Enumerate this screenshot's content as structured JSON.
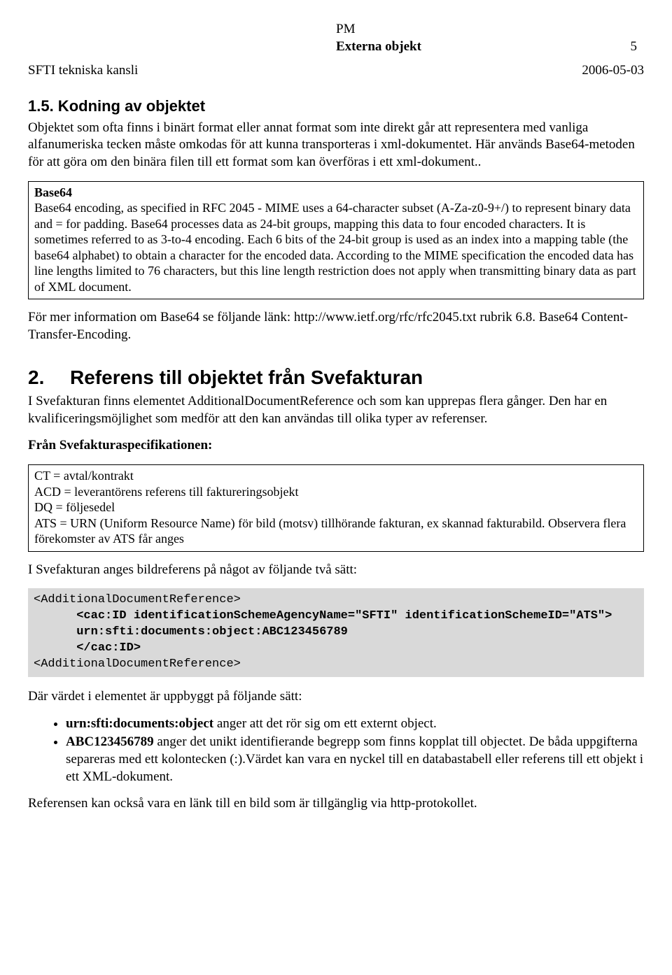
{
  "header": {
    "pm": "PM",
    "title": "Externa objekt",
    "page_number": "5",
    "org": "SFTI tekniska kansli",
    "date": "2006-05-03"
  },
  "section15": {
    "heading": "1.5. Kodning av objektet",
    "para1": "Objektet som ofta finns i binärt format eller annat format som inte direkt går att representera med vanliga alfanumeriska tecken måste omkodas för att kunna transporteras i xml-dokumentet. Här används Base64-metoden för att göra om den binära filen till ett format som kan överföras i ett xml-dokument..",
    "box": {
      "title": "Base64",
      "body": "Base64 encoding, as specified in RFC 2045 - MIME uses a 64-character subset (A-Za-z0-9+/) to represent binary data and = for padding. Base64 processes data as 24-bit groups, mapping this data to four encoded characters. It is sometimes referred to as 3-to-4 encoding. Each 6 bits of the 24-bit group is used as an index into a mapping table (the base64 alphabet) to obtain a character for the encoded data. According to the MIME specification the encoded data has line lengths limited to 76 characters, but this line length restriction does not apply when transmitting binary data as part of XML document."
    },
    "para2": "För mer information om Base64 se följande länk: http://www.ietf.org/rfc/rfc2045.txt rubrik 6.8. Base64 Content-Transfer-Encoding."
  },
  "section2": {
    "num": "2.",
    "heading": "Referens till objektet från Svefakturan",
    "para1": "I Svefakturan finns elementet AdditionalDocumentReference och som kan upprepas flera gånger. Den har en kvalificeringsmöjlighet som medför att den kan användas till olika typer av referenser.",
    "spec_label": "Från Svefakturaspecifikationen:",
    "box": "CT = avtal/kontrakt\nACD = leverantörens referens till faktureringsobjekt\nDQ = följesedel\nATS = URN (Uniform Resource Name) för bild (motsv) tillhörande fakturan, ex skannad fakturabild. Observera flera förekomster av ATS får anges",
    "para2": "I Svefakturan anges bildreferens på något av följande två sätt:",
    "code": {
      "l1": "<AdditionalDocumentReference>",
      "l2a": "      <cac:ID identificationSchemeAgencyName=\"SFTI\" identificationSchemeID=\"ATS\">",
      "l2b": "      urn:sfti:documents:object:ABC123456789",
      "l2c": "      </cac:ID>",
      "l3": "<AdditionalDocumentReference>"
    },
    "para3": "Där värdet i elementet är uppbyggt på följande sätt:",
    "bullets": [
      {
        "bold": "urn:sfti:documents:object",
        "rest": " anger att det rör sig om ett externt object."
      },
      {
        "bold": "ABC123456789",
        "rest": " anger det unikt identifierande begrepp som finns kopplat till objectet. De båda uppgifterna separeras med ett kolontecken (:).Värdet kan vara en nyckel till en databastabell eller referens till ett objekt i ett XML-dokument."
      }
    ],
    "para4": "Referensen kan också vara en länk till en bild som är tillgänglig via http-protokollet."
  }
}
